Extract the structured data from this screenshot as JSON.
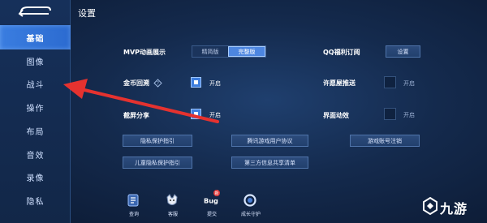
{
  "header": {
    "title": "设置"
  },
  "sidebar": {
    "items": [
      {
        "label": "基础",
        "active": true
      },
      {
        "label": "图像"
      },
      {
        "label": "战斗"
      },
      {
        "label": "操作"
      },
      {
        "label": "布局"
      },
      {
        "label": "音效"
      },
      {
        "label": "录像"
      },
      {
        "label": "隐私"
      }
    ]
  },
  "settings": {
    "mvp": {
      "label": "MVP动画展示",
      "options": [
        "精简版",
        "完整版"
      ],
      "selected": "完整版"
    },
    "qq_welfare": {
      "label": "QQ福利订阅",
      "button": "设置"
    },
    "coin_recycle": {
      "label": "金币回溯",
      "state_text": "开启",
      "checked": true
    },
    "wish_push": {
      "label": "许愿屋推送",
      "state_text": "开启",
      "checked": false
    },
    "screenshot_share": {
      "label": "截屏分享",
      "state_text": "开启",
      "checked": true
    },
    "ui_effects": {
      "label": "界面动效",
      "state_text": "开启",
      "checked": false
    }
  },
  "links": {
    "privacy_guide": "隐私保护指引",
    "user_agreement": "腾讯游戏用户协议",
    "account_cancel": "游戏账号注销",
    "child_privacy": "儿童隐私保护指引",
    "third_party_list": "第三方信息共享清单"
  },
  "bottom_bar": {
    "items": [
      {
        "label": "查询",
        "icon": "query-icon"
      },
      {
        "label": "客服",
        "icon": "customer-service-icon"
      },
      {
        "label": "提交",
        "icon": "bug-report-icon",
        "badge": "新"
      },
      {
        "label": "成长守护",
        "icon": "growth-guard-icon"
      }
    ]
  },
  "watermark": {
    "text": "九游"
  },
  "colors": {
    "accent": "#3e7ede",
    "annotation_arrow": "#e5322f",
    "background": "#142a4d"
  }
}
